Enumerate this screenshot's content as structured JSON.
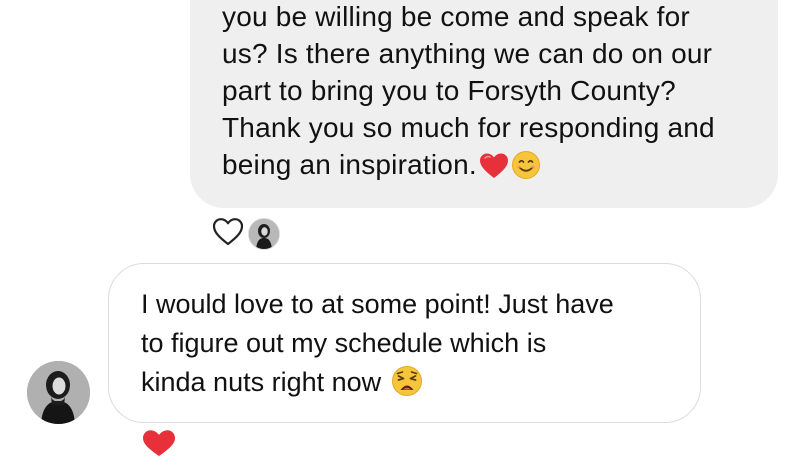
{
  "conversation": {
    "sent_message": {
      "lines": [
        "you be willing be come and speak for",
        "us? Is there anything we can do on our",
        "part to bring you to Forsyth County?",
        "Thank you so much for responding and",
        "being an inspiration."
      ],
      "trailing_emojis": [
        "red-heart-emoji",
        "smiling-face-emoji"
      ],
      "reaction": {
        "liked": false,
        "icon": "heart-outline-icon"
      }
    },
    "received_message": {
      "lines": [
        "I would love to at some point! Just have",
        "to figure out my schedule which is",
        "kinda nuts right now"
      ],
      "trailing_emoji": "weary-face-emoji",
      "reaction": {
        "liked": true,
        "icon": "heart-filled-icon"
      }
    }
  },
  "colors": {
    "sent_bubble": "#efefef",
    "received_border": "#dcdcdc",
    "heart_red": "#e8303a",
    "text": "#111111",
    "emoji_yellow": "#f7c53c"
  }
}
